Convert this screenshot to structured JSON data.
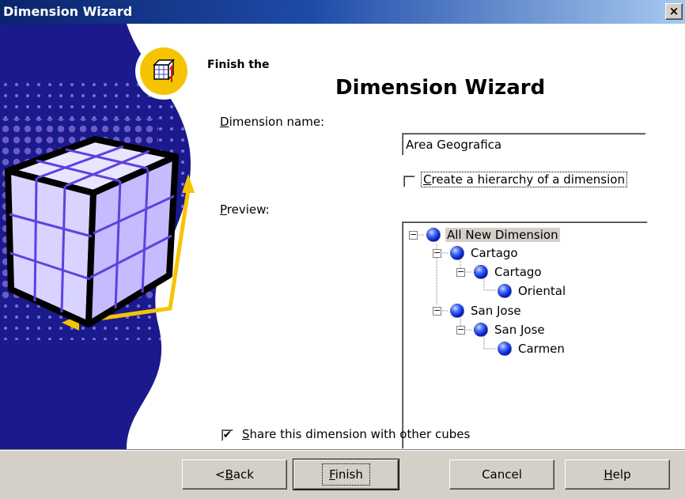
{
  "window": {
    "title": "Dimension Wizard",
    "close_label": "×"
  },
  "heading": {
    "small": "Finish the",
    "big": "Dimension Wizard"
  },
  "form": {
    "dimension_name_label_first": "D",
    "dimension_name_label_rest": "imension name:",
    "dimension_name_value": "Area Geografica",
    "hierarchy_label_first": "C",
    "hierarchy_label_rest": "reate a hierarchy of a dimension",
    "hierarchy_checked": false,
    "preview_label_first": "P",
    "preview_label_rest": "review:",
    "share_label_first": "S",
    "share_label_rest": "hare this dimension with other cubes",
    "share_checked": true,
    "share_mark": "✔"
  },
  "tree": {
    "root": "All New Dimension",
    "n1": "Cartago",
    "n1_1": "Cartago",
    "n1_1_1": "Oriental",
    "n2": "San Jose",
    "n2_1": "San Jose",
    "n2_1_1": "Carmen",
    "expander_symbol": "−"
  },
  "buttons": {
    "back_prefix": "< ",
    "back_first": "B",
    "back_rest": "ack",
    "finish_first": "F",
    "finish_rest": "inish",
    "cancel": "Cancel",
    "help_first": "H",
    "help_rest": "elp"
  },
  "colors": {
    "titlebar_start": "#0a246a",
    "titlebar_end": "#a6caf0",
    "graphic_blue": "#1a1a8c",
    "graphic_yellow": "#f5c400"
  }
}
